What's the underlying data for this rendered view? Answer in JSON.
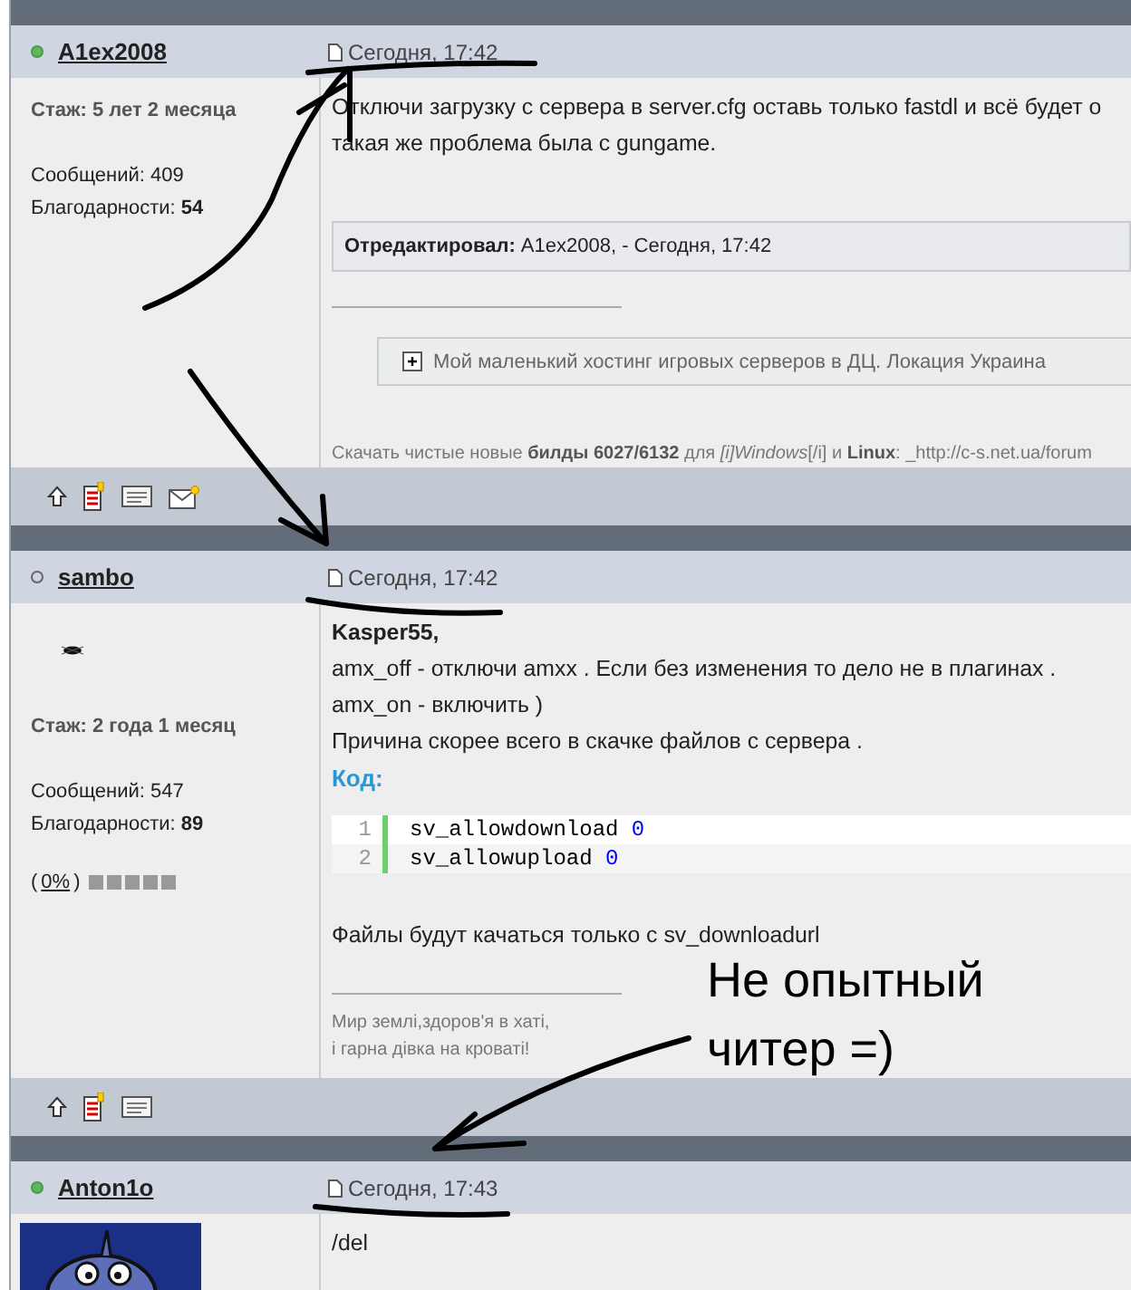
{
  "posts": [
    {
      "author": "A1ex2008",
      "online": true,
      "date": "Сегодня, 17:42",
      "tenure": "Стаж: 5 лет 2 месяца",
      "messages": "Сообщений: 409",
      "thanks": "Благодарности: **54**",
      "blocks": [
        {
          "kind": "text",
          "lines": [
            "Отключи загрузку с сервера в server.cfg оставь только fastdl и всё будет о",
            "такая же проблема была с gungame."
          ]
        },
        {
          "kind": "edit_note",
          "text": "**Отредактировал:** A1ex2008, - Сегодня, 17:42"
        },
        {
          "kind": "rule"
        },
        {
          "kind": "spoiler",
          "text": "Мой маленький хостинг игровых серверов в ДЦ. Локация Украина"
        },
        {
          "kind": "signature",
          "lines": [
            "Скачать чистые новые **билды 6027/6132** для *[i]Windows*[/i] и **Linux**: _http://c-s.net.ua/forum"
          ]
        }
      ],
      "actions": [
        {
          "kind": "up"
        },
        {
          "kind": "report"
        },
        {
          "kind": "card"
        },
        {
          "kind": "mail"
        }
      ]
    },
    {
      "author": "sambo",
      "online": false,
      "date": "Сегодня, 17:42",
      "avatar": {
        "kind": "small"
      },
      "tenure": "Стаж: 2 года 1 месяц",
      "messages": "Сообщений: 547",
      "thanks": "Благодарности: **89**",
      "reputation": {
        "open": "(",
        "value": "0%",
        "close": ")",
        "stars": 0
      },
      "blocks": [
        {
          "kind": "text",
          "lines": [
            "**Kasper55,**",
            "amx_off - отключи amxx . Если без изменения то дело не в плагинах .",
            "amx_on - включить )",
            "Причина скорее всего в скачке файлов с сервера ."
          ]
        },
        {
          "kind": "code",
          "label": "Код:",
          "lines": [
            {
              "number": "1",
              "code": "sv_allowdownload",
              "value": "0"
            },
            {
              "number": "2",
              "code": "sv_allowupload",
              "value": "0"
            }
          ]
        },
        {
          "kind": "text",
          "lines": [
            "Файлы будут качаться только с sv_downloadurl"
          ]
        },
        {
          "kind": "rule"
        },
        {
          "kind": "signature",
          "lines": [
            "Мир землі,здоров'я в хаті,",
            "і гарна дівка на кроваті!"
          ]
        }
      ],
      "actions": [
        {
          "kind": "up"
        },
        {
          "kind": "report"
        },
        {
          "kind": "card"
        }
      ]
    },
    {
      "author": "Anton1o",
      "online": true,
      "date": "Сегодня, 17:43",
      "avatar": {
        "kind": "picture"
      },
      "blocks": [
        {
          "kind": "text",
          "lines": [
            "/del"
          ]
        }
      ]
    }
  ],
  "annotation": {
    "lines": [
      "Не опытный",
      "читер =)"
    ]
  }
}
